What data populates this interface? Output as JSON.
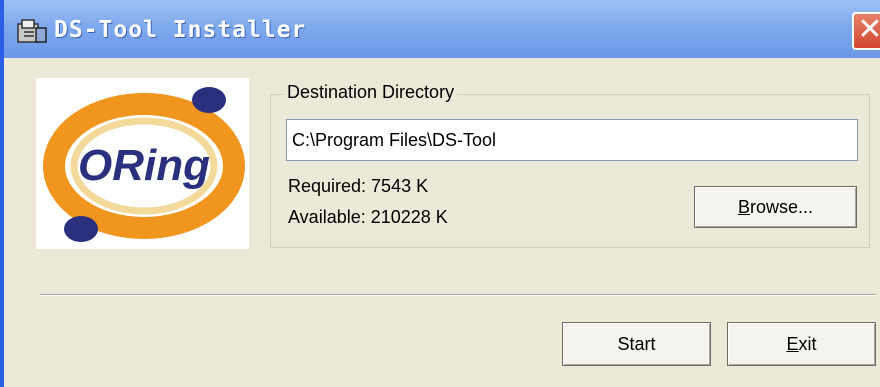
{
  "window": {
    "title": "DS-Tool Installer",
    "close_label": "✕"
  },
  "logo": {
    "text": "ORing",
    "colors": {
      "ring": "#f0961e",
      "dots": "#2a2f7e",
      "text": "#2a2f7e",
      "inner": "#f3d99a"
    }
  },
  "destination": {
    "group_label": "Destination Directory",
    "path_value": "C:\\Program Files\\DS-Tool",
    "required": "Required: 7543 K",
    "available": "Available: 210228 K"
  },
  "buttons": {
    "browse": {
      "mnemonic": "B",
      "rest": "rowse..."
    },
    "start": {
      "label": "Start"
    },
    "exit": {
      "mnemonic": "E",
      "rest": "xit"
    }
  },
  "icons": {
    "title": "installer-icon",
    "close": "close-icon"
  }
}
